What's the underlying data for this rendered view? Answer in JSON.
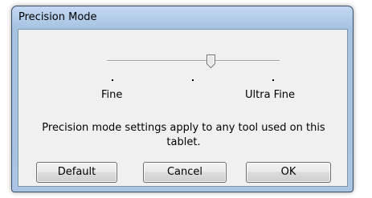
{
  "window": {
    "title": "Precision Mode"
  },
  "slider": {
    "label_min": "Fine",
    "label_max": "Ultra Fine",
    "value_fraction": 0.6
  },
  "message": "Precision mode settings apply to any tool used on this tablet.",
  "buttons": {
    "default_label": "Default",
    "cancel_label": "Cancel",
    "ok_label": "OK"
  }
}
